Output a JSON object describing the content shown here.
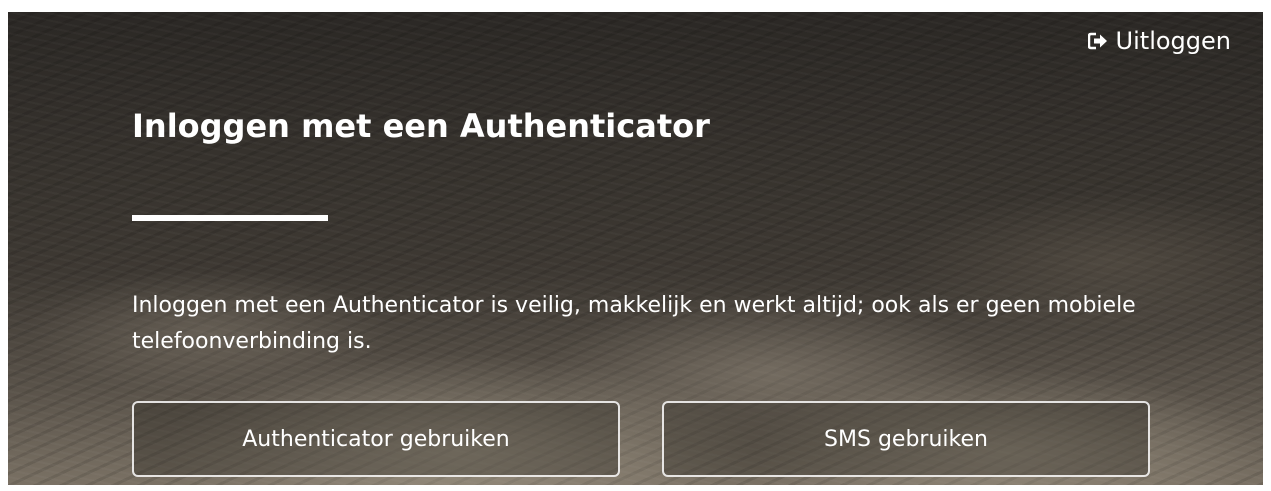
{
  "header": {
    "logout_label": "Uitloggen",
    "logout_icon": "sign-out-icon"
  },
  "main": {
    "title": "Inloggen met een Authenticator",
    "description": "Inloggen met een Authenticator is veilig, makkelijk en werkt altijd; ook als er geen mobiele telefoonverbinding is.",
    "buttons": [
      {
        "label": "Authenticator gebruiken"
      },
      {
        "label": "SMS gebruiken"
      }
    ]
  },
  "colors": {
    "text": "#ffffff",
    "accent_line": "#ffffff",
    "button_border": "#ffffff",
    "background_dark": "#2b2825"
  }
}
